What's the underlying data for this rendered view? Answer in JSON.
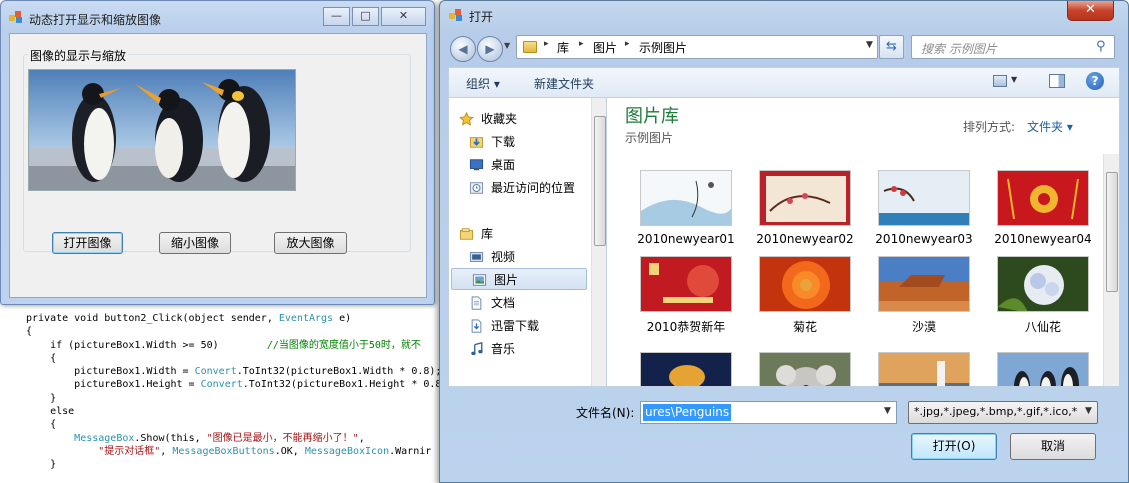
{
  "code_editor": {
    "lines": [
      [
        {
          "t": "private void button2_Click(object sender, "
        },
        {
          "t": "EventArgs",
          "c": "ty"
        },
        {
          "t": " e)"
        }
      ],
      [
        {
          "t": "{"
        }
      ],
      [
        {
          "t": "    if (pictureBox1.Width >= 50)        "
        },
        {
          "t": "//当图像的宽度值小于50时，就不",
          "c": "cm"
        }
      ],
      [
        {
          "t": "    {"
        }
      ],
      [
        {
          "t": "        pictureBox1.Width = "
        },
        {
          "t": "Convert",
          "c": "ty"
        },
        {
          "t": ".ToInt32(pictureBox1.Width * 0.8);"
        }
      ],
      [
        {
          "t": "        pictureBox1.Height = "
        },
        {
          "t": "Convert",
          "c": "ty"
        },
        {
          "t": ".ToInt32(pictureBox1.Height * 0.8"
        }
      ],
      [
        {
          "t": "    }"
        }
      ],
      [
        {
          "t": "    else"
        }
      ],
      [
        {
          "t": "    {"
        }
      ],
      [
        {
          "t": "        "
        },
        {
          "t": "MessageBox",
          "c": "ty"
        },
        {
          "t": ".Show(this, "
        },
        {
          "t": "\"图像已是最小，不能再缩小了！\"",
          "c": "st"
        },
        {
          "t": ","
        }
      ],
      [
        {
          "t": "            "
        },
        {
          "t": "\"提示对话框\"",
          "c": "st"
        },
        {
          "t": ", "
        },
        {
          "t": "MessageBoxButtons",
          "c": "ty"
        },
        {
          "t": ".OK, "
        },
        {
          "t": "MessageBoxIcon",
          "c": "ty"
        },
        {
          "t": ".Warnir"
        }
      ],
      [
        {
          "t": "    }"
        }
      ]
    ]
  },
  "form": {
    "title": "动态打开显示和缩放图像",
    "caption_buttons": {
      "minimize": "—",
      "maximize": "□",
      "close": "✕"
    },
    "group_title": "图像的显示与缩放",
    "buttons": {
      "open": "打开图像",
      "shrink": "缩小图像",
      "enlarge": "放大图像"
    }
  },
  "dialog": {
    "title": "打开",
    "close_glyph": "✕",
    "nav": {
      "back": "◀",
      "forward": "▶",
      "dropdown": "▼"
    },
    "breadcrumb": [
      "库",
      "图片",
      "示例图片"
    ],
    "breadcrumb_sep": "▸",
    "refresh_glyph": "⇆",
    "search_placeholder": "搜索 示例图片",
    "search_glyph": "⚲",
    "commands": {
      "organize": "组织 ▾",
      "new_folder": "新建文件夹",
      "help": "?"
    },
    "nav_pane": {
      "favorites": "收藏夹",
      "items_fav": [
        "下载",
        "桌面",
        "最近访问的位置"
      ],
      "libraries": "库",
      "items_lib": [
        "视频",
        "图片",
        "文档",
        "迅雷下载",
        "音乐"
      ]
    },
    "library": {
      "title": "图片库",
      "subtitle": "示例图片",
      "arrange_label": "排列方式:",
      "arrange_value": "文件夹 ▾"
    },
    "thumbnails": [
      {
        "name": "2010newyear01",
        "kind": "ny01"
      },
      {
        "name": "2010newyear02",
        "kind": "ny02"
      },
      {
        "name": "2010newyear03",
        "kind": "ny03"
      },
      {
        "name": "2010newyear04",
        "kind": "ny04"
      },
      {
        "name": "2010恭贺新年",
        "kind": "gh"
      },
      {
        "name": "菊花",
        "kind": "flower"
      },
      {
        "name": "沙漠",
        "kind": "desert"
      },
      {
        "name": "八仙花",
        "kind": "hydrangea"
      },
      {
        "name": "",
        "kind": "jellyfish"
      },
      {
        "name": "",
        "kind": "koala"
      },
      {
        "name": "",
        "kind": "lighthouse"
      },
      {
        "name": "",
        "kind": "penguins"
      }
    ],
    "filename_label": "文件名(N):",
    "filename_value": "ures\\Penguins",
    "filter_value": "*.jpg,*.jpeg,*.bmp,*.gif,*.ico,*",
    "buttons": {
      "open": "打开(O)",
      "cancel": "取消"
    }
  }
}
